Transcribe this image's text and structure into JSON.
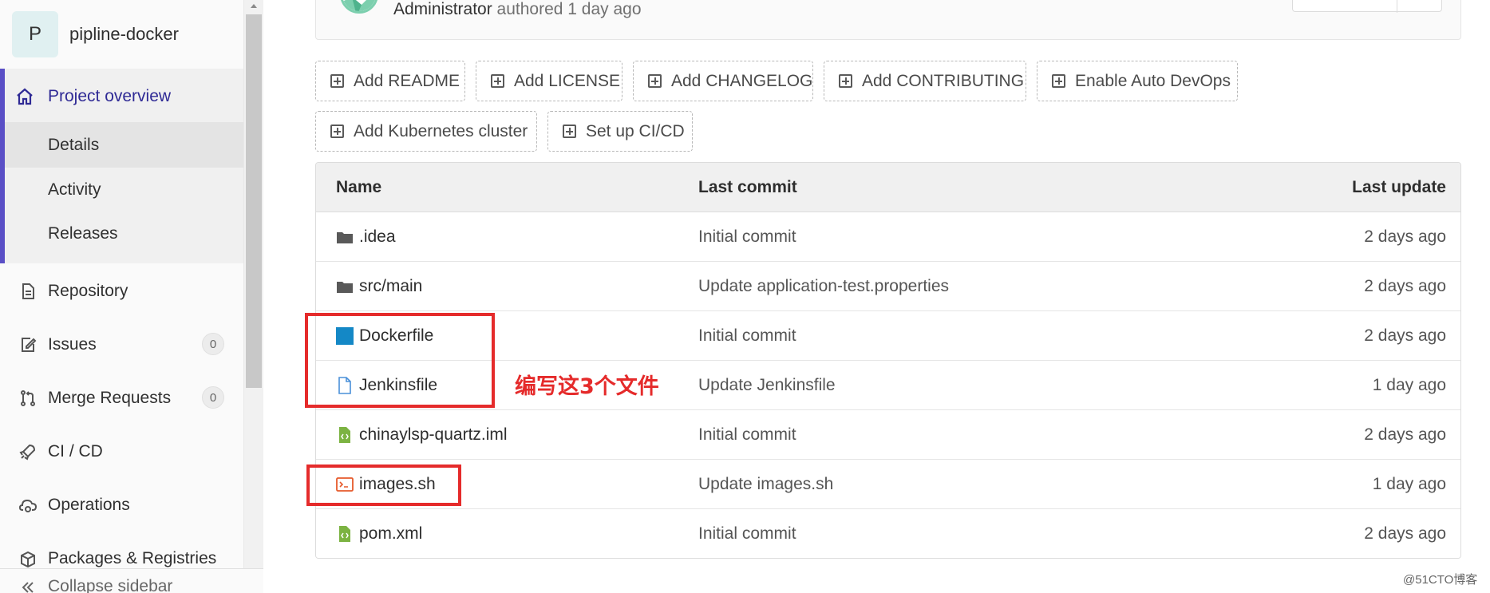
{
  "sidebar": {
    "project_initial": "P",
    "project_name": "pipline-docker",
    "overview_label": "Project overview",
    "overview_items": [
      "Details",
      "Activity",
      "Releases"
    ],
    "repository_label": "Repository",
    "issues_label": "Issues",
    "issues_count": "0",
    "merge_label": "Merge Requests",
    "merge_count": "0",
    "cicd_label": "CI / CD",
    "operations_label": "Operations",
    "packages_label": "Packages & Registries",
    "collapse_label": "Collapse sidebar",
    "accent_color": "#5a4fc6"
  },
  "commit": {
    "author": "Administrator",
    "authored_text": "authored 1 day ago"
  },
  "actions": [
    "Add README",
    "Add LICENSE",
    "Add CHANGELOG",
    "Add CONTRIBUTING",
    "Enable Auto DevOps",
    "Add Kubernetes cluster",
    "Set up CI/CD"
  ],
  "table": {
    "headers": {
      "name": "Name",
      "last_commit": "Last commit",
      "last_update": "Last update"
    },
    "rows": [
      {
        "icon": "folder-icon",
        "name": ".idea",
        "commit": "Initial commit",
        "update": "2 days ago"
      },
      {
        "icon": "folder-icon",
        "name": "src/main",
        "commit": "Update application-test.properties",
        "update": "2 days ago"
      },
      {
        "icon": "docker-file-icon",
        "name": "Dockerfile",
        "commit": "Initial commit",
        "update": "2 days ago"
      },
      {
        "icon": "file-icon",
        "name": "Jenkinsfile",
        "commit": "Update Jenkinsfile",
        "update": "1 day ago"
      },
      {
        "icon": "xml-file-icon",
        "name": "chinaylsp-quartz.iml",
        "commit": "Initial commit",
        "update": "2 days ago"
      },
      {
        "icon": "shell-file-icon",
        "name": "images.sh",
        "commit": "Update images.sh",
        "update": "1 day ago"
      },
      {
        "icon": "xml-file-icon",
        "name": "pom.xml",
        "commit": "Initial commit",
        "update": "2 days ago"
      }
    ]
  },
  "annotation": {
    "note": "编写这3个文件",
    "color": "#e52b2b"
  },
  "watermark": "@51CTO博客"
}
